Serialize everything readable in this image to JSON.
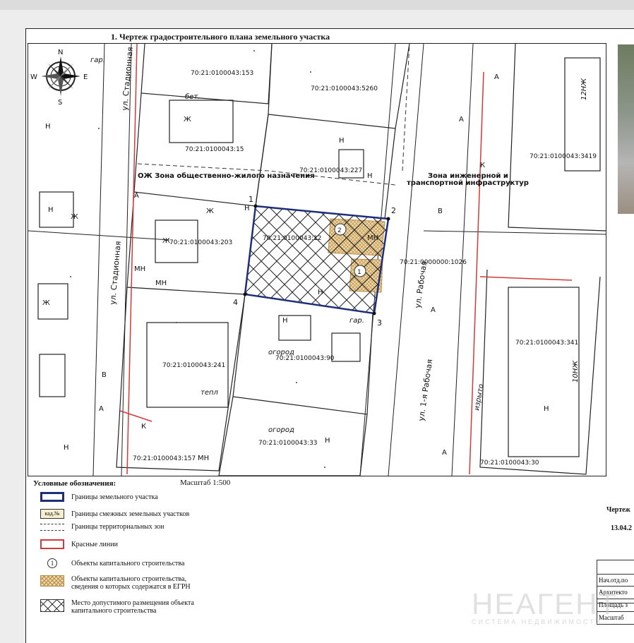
{
  "title": "1. Чертеж градостроительного плана земельного участка",
  "scale": "Масштаб 1:500",
  "compass": {
    "n": "N",
    "s": "S",
    "w": "W",
    "e": "E"
  },
  "parcels": {
    "p153": "70:21:0100043:153",
    "p5260": "70:21:0100043:5260",
    "p15": "70:21:0100043:15",
    "p227": "70:21:0100043:227",
    "p3419": "70:21:0100043:3419",
    "p12": "70:21:0100043:12",
    "p203": "70:21:0100043:203",
    "p1026": "70:21:0000000:1026",
    "p3410": "70:21:0100043:341",
    "p241": "70:21:0100043:241",
    "p90": "70:21:0100043:90",
    "p33": "70:21:0100043:33",
    "p157": "70:21:0100043:157",
    "p30": "70:21:0100043:30"
  },
  "zones": {
    "ozh": "ОЖ Зона общественно-жилого назначения",
    "eng1": "Зона инженерной и",
    "eng2": "транспортной инфраструктур"
  },
  "streets": {
    "stad1": "ул. Стадионная",
    "stad2": "ул. Стадионная",
    "rab1": "ул. Рабочая",
    "rab2": "ул. 1-я Рабочая"
  },
  "labels": {
    "gar1": "гар.",
    "gar2": "гар.",
    "bet": "бет.",
    "ogorod1": "огород",
    "ogorod2": "огород",
    "tepl": "тепл",
    "izrito": "изрыто",
    "unzh": "10НЖ",
    "unzh2": "12НЖ",
    "mn": "МН",
    "h": "Н",
    "zh": "Ж",
    "a": "А",
    "v": "В",
    "k": "К"
  },
  "corners": [
    "1",
    "2",
    "3",
    "4"
  ],
  "objects": [
    "1",
    "2"
  ],
  "legend": {
    "title": "Условные обозначения:",
    "items": [
      {
        "label": "Границы земельного участка"
      },
      {
        "label": "Границы смежных земельных участков",
        "symbol": "кад.№"
      },
      {
        "label": "Границы территориальных зон"
      },
      {
        "label": "Красные линии"
      },
      {
        "label": "Объекты капитального строительства",
        "symbol": "1"
      },
      {
        "label": "Объекты капитального строительства, сведения о которых содержатся в ЕГРН"
      },
      {
        "label": "Место допустимого размещения объекта капитального строительства"
      }
    ]
  },
  "right_panel": {
    "chertezh": "Чертеж",
    "date": "13.04.2",
    "rows": [
      "Нач.отд.по",
      "Архитекто",
      "Площадь з",
      "Масштаб"
    ]
  },
  "watermark": {
    "brand": "НЕАГЕНТ",
    "sub": "СИСТЕМА НЕДВИЖИМОСТИ"
  },
  "colors": {
    "plot_border": "#1e2f7a",
    "red_line": "#d43a3a",
    "egrn_fill": "#f0d9a8",
    "zone_text": "#111111"
  }
}
